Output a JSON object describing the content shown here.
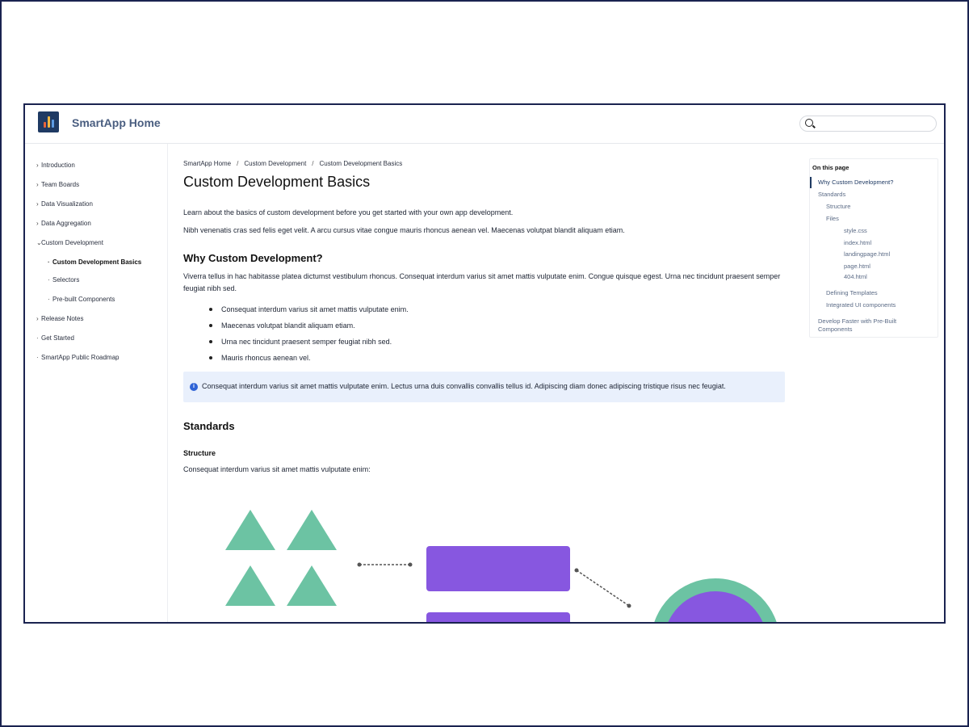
{
  "header": {
    "app_title": "SmartApp Home",
    "search_placeholder": ""
  },
  "sidebar": {
    "items": [
      {
        "label": "Introduction",
        "marker": "›"
      },
      {
        "label": "Team Boards",
        "marker": "›"
      },
      {
        "label": "Data Visualization",
        "marker": "›"
      },
      {
        "label": "Data Aggregation",
        "marker": "›"
      },
      {
        "label": "Custom Development",
        "marker": "⌄"
      },
      {
        "label": "Custom Development Basics",
        "marker": "·"
      },
      {
        "label": "Selectors",
        "marker": "·"
      },
      {
        "label": "Pre-built Components",
        "marker": "·"
      },
      {
        "label": "Release Notes",
        "marker": "›"
      },
      {
        "label": "Get Started",
        "marker": "·"
      },
      {
        "label": "SmartApp Public Roadmap",
        "marker": "·"
      }
    ]
  },
  "breadcrumb": [
    "SmartApp Home",
    "Custom Development",
    "Custom Development Basics"
  ],
  "breadcrumb_separator": "/",
  "page": {
    "title": "Custom Development Basics",
    "intro_1": "Learn about the basics of custom development before you get started with your own app development.",
    "intro_2": "Nibh venenatis cras sed felis eget velit. A arcu cursus vitae congue mauris rhoncus aenean vel. Maecenas volutpat blandit aliquam etiam.",
    "section_1_heading": "Why Custom Development?",
    "section_1_para": "Viverra tellus in hac habitasse platea dictumst vestibulum rhoncus. Consequat interdum varius sit amet mattis vulputate enim. Congue quisque egest. Urna nec tincidunt praesent semper feugiat nibh sed.",
    "bullets": [
      "Consequat interdum varius sit amet mattis vulputate enim.",
      "Maecenas volutpat blandit aliquam etiam.",
      "Urna nec tincidunt praesent semper feugiat nibh sed.",
      "Mauris rhoncus aenean vel."
    ],
    "callout_icon": "i",
    "callout": "Consequat interdum varius sit amet mattis vulputate enim. Lectus urna duis convallis convallis tellus id. Adipiscing diam donec adipiscing tristique risus nec feugiat.",
    "section_2_heading": "Standards",
    "subsection_heading": "Structure",
    "subsection_para": "Consequat interdum varius sit amet mattis vulputate enim:"
  },
  "toc": {
    "title": "On this page",
    "items": [
      "Why Custom Development?",
      "Standards",
      "Structure",
      "Files",
      "style.css",
      "index.html",
      "landingpage.html",
      "page.html",
      "404.html",
      "Defining Templates",
      "Integrated UI components",
      "Develop Faster with Pre-Built",
      "Components"
    ]
  },
  "colors": {
    "brand": "#1f3a63",
    "diagram_green": "#6cc3a3",
    "diagram_purple": "#8757e0",
    "callout_bg": "#e9f0fc"
  }
}
